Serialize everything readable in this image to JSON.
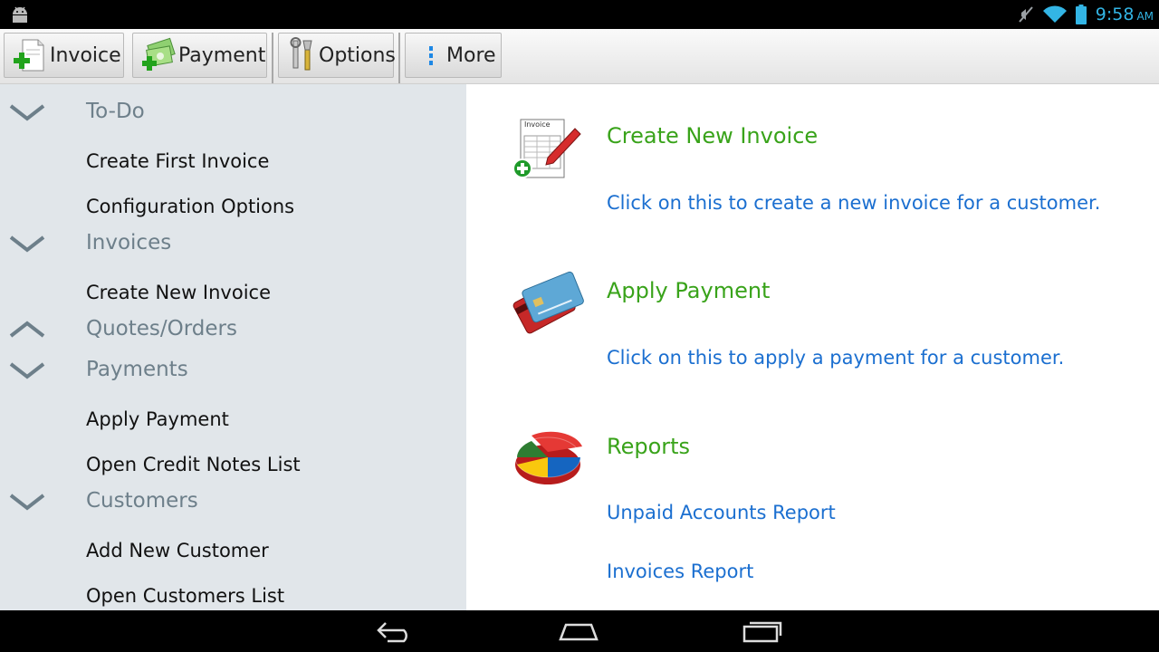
{
  "status_bar": {
    "time": "9:58",
    "ampm": "AM"
  },
  "toolbar": {
    "buttons": [
      {
        "label": "Invoice",
        "icon": "add-document-icon"
      },
      {
        "label": "Payment",
        "icon": "add-money-icon"
      },
      {
        "label": "Options",
        "icon": "tools-icon"
      },
      {
        "label": "More",
        "icon": "overflow-menu-icon"
      }
    ]
  },
  "sidebar": {
    "groups": [
      {
        "title": "To-Do",
        "state": "expanded",
        "items": [
          "Create First Invoice",
          "Configuration Options"
        ]
      },
      {
        "title": "Invoices",
        "state": "expanded",
        "items": [
          "Create New Invoice"
        ]
      },
      {
        "title": "Quotes/Orders",
        "state": "collapsed",
        "items": []
      },
      {
        "title": "Payments",
        "state": "expanded",
        "items": [
          "Apply Payment",
          "Open Credit Notes List"
        ]
      },
      {
        "title": "Customers",
        "state": "expanded",
        "items": [
          "Add New Customer",
          "Open Customers List"
        ]
      }
    ]
  },
  "main": {
    "sections": [
      {
        "title": "Create New Invoice",
        "icon": "invoice-pen-icon",
        "links": [
          "Click on this to create a new invoice for a customer."
        ]
      },
      {
        "title": "Apply Payment",
        "icon": "credit-cards-icon",
        "links": [
          "Click on this to apply a payment for a customer."
        ]
      },
      {
        "title": "Reports",
        "icon": "pie-chart-icon",
        "links": [
          "Unpaid Accounts Report",
          "Invoices Report"
        ]
      }
    ],
    "invoice_icon_text": "Invoice"
  },
  "colors": {
    "accent_green": "#39a31a",
    "link_blue": "#1b6fd0",
    "sidebar_bg": "#e1e6ea",
    "group_title": "#6d7f8a",
    "clock": "#33b5e5"
  }
}
